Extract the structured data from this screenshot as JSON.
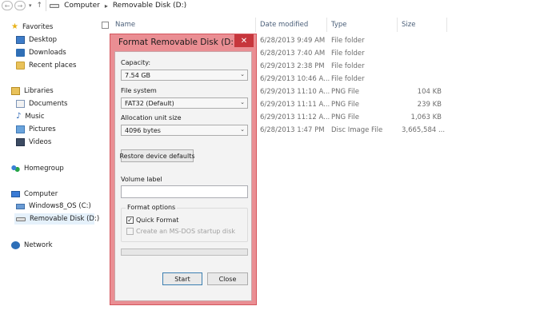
{
  "address_bar": {
    "back_glyph": "←",
    "forward_glyph": "→",
    "recent_glyph": "▾",
    "up_glyph": "↑",
    "crumbs": [
      "Computer",
      "Removable Disk (D:)"
    ],
    "separator": "▸"
  },
  "sidebar": {
    "favorites": {
      "label": "Favorites",
      "icon": "star-icon",
      "items": [
        {
          "label": "Desktop",
          "icon": "desktop-icon"
        },
        {
          "label": "Downloads",
          "icon": "downloads-icon"
        },
        {
          "label": "Recent places",
          "icon": "recent-places-icon"
        }
      ]
    },
    "libraries": {
      "label": "Libraries",
      "icon": "libraries-icon",
      "items": [
        {
          "label": "Documents",
          "icon": "documents-icon"
        },
        {
          "label": "Music",
          "icon": "music-icon"
        },
        {
          "label": "Pictures",
          "icon": "pictures-icon"
        },
        {
          "label": "Videos",
          "icon": "videos-icon"
        }
      ]
    },
    "homegroup": {
      "label": "Homegroup",
      "icon": "homegroup-icon"
    },
    "computer": {
      "label": "Computer",
      "icon": "computer-icon",
      "items": [
        {
          "label": "Windows8_OS (C:)",
          "icon": "windows-drive-icon"
        },
        {
          "label": "Removable Disk (D:)",
          "icon": "removable-disk-icon",
          "selected": true
        }
      ]
    },
    "network": {
      "label": "Network",
      "icon": "network-icon"
    }
  },
  "file_list": {
    "columns": [
      "Name",
      "Date modified",
      "Type",
      "Size"
    ],
    "rows": [
      {
        "date": "6/28/2013 9:49 AM",
        "type": "File folder",
        "size": ""
      },
      {
        "date": "6/28/2013 7:40 AM",
        "type": "File folder",
        "size": ""
      },
      {
        "date": "6/29/2013 2:38 PM",
        "type": "File folder",
        "size": ""
      },
      {
        "date": "6/29/2013 10:46 A...",
        "type": "File folder",
        "size": ""
      },
      {
        "date": "6/29/2013 11:10 A...",
        "type": "PNG File",
        "size": "104 KB"
      },
      {
        "date": "6/29/2013 11:11 A...",
        "type": "PNG File",
        "size": "239 KB"
      },
      {
        "date": "6/29/2013 11:12 A...",
        "type": "PNG File",
        "size": "1,063 KB"
      },
      {
        "date": "6/28/2013 1:47 PM",
        "type": "Disc Image File",
        "size": "3,665,584 ..."
      }
    ]
  },
  "format_dialog": {
    "title": "Format Removable Disk (D:)",
    "close_glyph": "✕",
    "capacity_label": "Capacity:",
    "capacity_value": "7.54 GB",
    "file_system_label": "File system",
    "file_system_value": "FAT32 (Default)",
    "allocation_label": "Allocation unit size",
    "allocation_value": "4096 bytes",
    "restore_button": "Restore device defaults",
    "volume_label": "Volume label",
    "volume_value": "",
    "format_options_label": "Format options",
    "quick_format_label": "Quick Format",
    "quick_format_checked": true,
    "msdos_label": "Create an MS-DOS startup disk",
    "msdos_checked": false,
    "progress": 0,
    "start_button": "Start",
    "close_button": "Close",
    "caret_glyph": "⌄",
    "check_glyph": "✓"
  },
  "colors": {
    "dialog_frame": "#ea8e93",
    "close_button_bg": "#c7363c",
    "progress_fill": "#06b025"
  }
}
